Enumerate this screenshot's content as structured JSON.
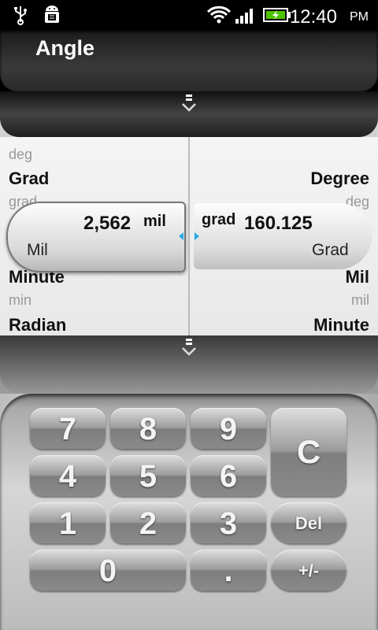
{
  "status_bar": {
    "time": "12:40",
    "ampm": "PM",
    "icons": [
      "usb-icon",
      "android-debug-icon",
      "wifi-icon",
      "signal-icon",
      "battery-charging-icon"
    ]
  },
  "app": {
    "title": "Angle"
  },
  "converter": {
    "left_list": [
      {
        "text": "deg",
        "kind": "abbr"
      },
      {
        "text": "Grad",
        "kind": "name"
      },
      {
        "text": "grad",
        "kind": "abbr"
      },
      {
        "text": "Minute",
        "kind": "name"
      },
      {
        "text": "min",
        "kind": "abbr"
      },
      {
        "text": "Radian",
        "kind": "name"
      }
    ],
    "right_list": [
      {
        "text": "Degree",
        "kind": "name"
      },
      {
        "text": "deg",
        "kind": "abbr"
      },
      {
        "text": "Mil",
        "kind": "name"
      },
      {
        "text": "mil",
        "kind": "abbr"
      },
      {
        "text": "Minute",
        "kind": "name"
      }
    ],
    "from": {
      "value": "2,562",
      "unit_abbr": "mil",
      "unit_name": "Mil"
    },
    "to": {
      "value": "160.125",
      "unit_abbr": "grad",
      "unit_name": "Grad"
    }
  },
  "keypad": {
    "keys": [
      "7",
      "8",
      "9",
      "C",
      "4",
      "5",
      "6",
      "1",
      "2",
      "3",
      "Del",
      "0",
      ".",
      "+/-"
    ]
  },
  "colors": {
    "accent": "#2aa7e8",
    "battery": "#4ec400"
  }
}
